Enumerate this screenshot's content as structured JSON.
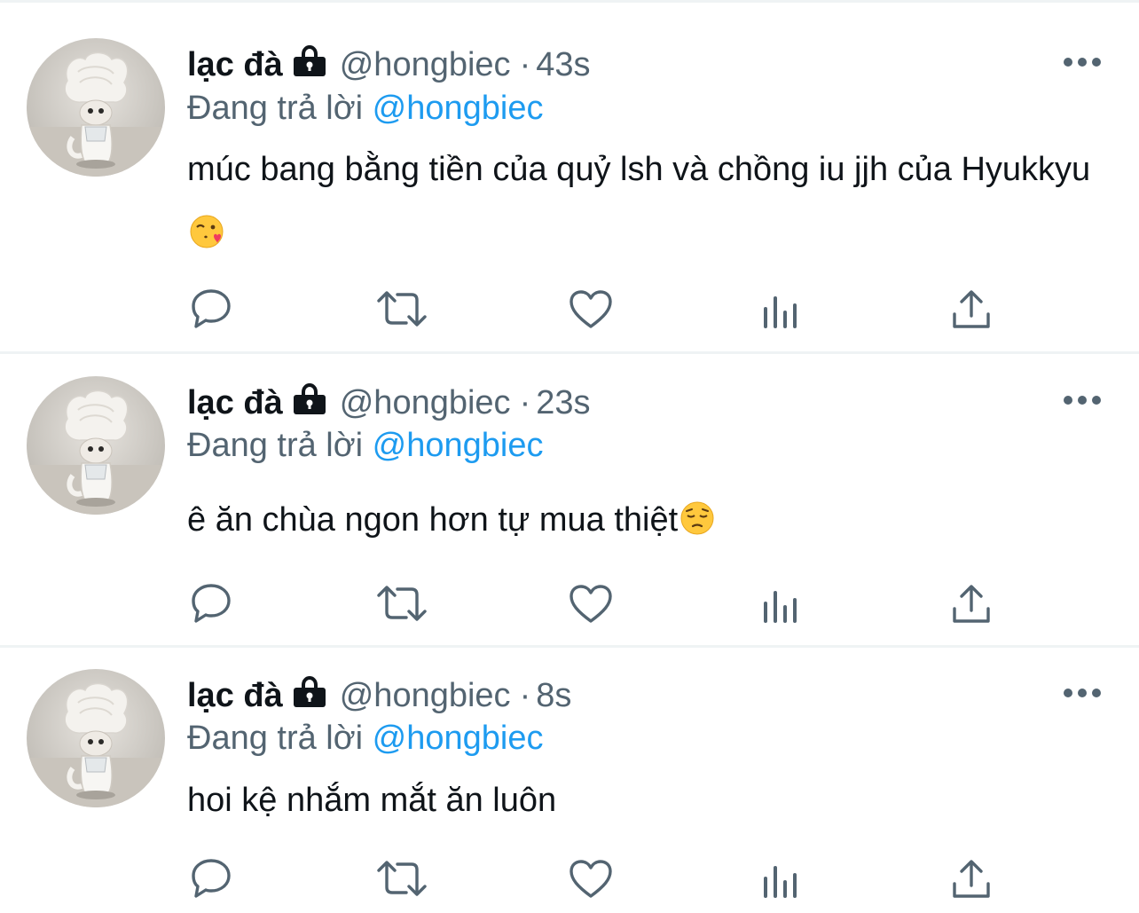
{
  "tweets": [
    {
      "display_name": "lạc đà",
      "handle": "@hongbiec",
      "separator": "·",
      "time": "43s",
      "reply_prefix": "Đang trả lời",
      "reply_to": "@hongbiec",
      "text": "múc bang bằng tiền của quỷ lsh và chồng iu jjh của Hyukkyu",
      "emoji": "face-blowing-kiss-emoji"
    },
    {
      "display_name": "lạc đà",
      "handle": "@hongbiec",
      "separator": "·",
      "time": "23s",
      "reply_prefix": "Đang trả lời",
      "reply_to": "@hongbiec",
      "text": "ê ăn chùa ngon hơn tự mua thiệt",
      "emoji": "pensive-face-emoji"
    },
    {
      "display_name": "lạc đà",
      "handle": "@hongbiec",
      "separator": "·",
      "time": "8s",
      "reply_prefix": "Đang trả lời",
      "reply_to": "@hongbiec",
      "text": "hoi kệ nhắm mắt ăn luôn",
      "emoji": ""
    }
  ],
  "icons": {
    "lock": "lock-icon",
    "more": "more-icon",
    "reply": "reply-icon",
    "retweet": "retweet-icon",
    "like": "heart-icon",
    "views": "views-icon",
    "share": "share-icon"
  },
  "colors": {
    "text_primary": "#0f1419",
    "text_secondary": "#536471",
    "mention": "#1d9bf0",
    "divider": "#eff3f4"
  }
}
